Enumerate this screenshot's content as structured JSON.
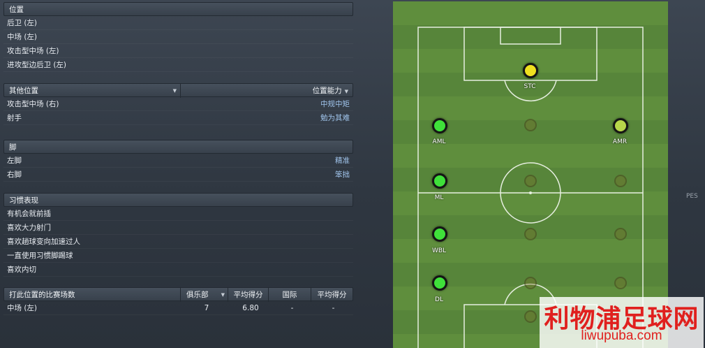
{
  "positions": {
    "title": "位置",
    "items": [
      "后卫 (左)",
      "中场 (左)",
      "攻击型中场 (左)",
      "进攻型边后卫 (左)"
    ]
  },
  "other_positions": {
    "col1": "其他位置",
    "col2": "位置能力",
    "rows": [
      {
        "label": "攻击型中场 (右)",
        "value": "中规中矩"
      },
      {
        "label": "射手",
        "value": "勉为其难"
      }
    ]
  },
  "foot": {
    "title": "脚",
    "rows": [
      {
        "label": "左脚",
        "value": "精准"
      },
      {
        "label": "右脚",
        "value": "笨拙"
      }
    ]
  },
  "habits": {
    "title": "习惯表现",
    "items": [
      "有机会就前插",
      "喜欢大力射门",
      "喜欢趟球变向加速过人",
      "一直使用习惯脚踢球",
      "喜欢内切"
    ]
  },
  "matches": {
    "headers": [
      "打此位置的比赛场数",
      "俱乐部",
      "平均得分",
      "国际",
      "平均得分"
    ],
    "row": {
      "position": "中场 (左)",
      "club": "7",
      "avg": "6.80",
      "intl": "-",
      "intl_avg": "-"
    }
  },
  "pitch": {
    "labels": {
      "stc": "STC",
      "aml": "AML",
      "amr": "AMR",
      "ml": "ML",
      "wbl": "WBL",
      "dl": "DL"
    },
    "colors": {
      "natural": "#3fe03a",
      "accomplished": "#b7d64a",
      "selected": "#f0e020",
      "line": "#e6eee0"
    }
  },
  "overlay": {
    "pes_text": "PES",
    "watermark_cn": "利物浦足球网",
    "watermark_url": "liwupuba.com"
  }
}
